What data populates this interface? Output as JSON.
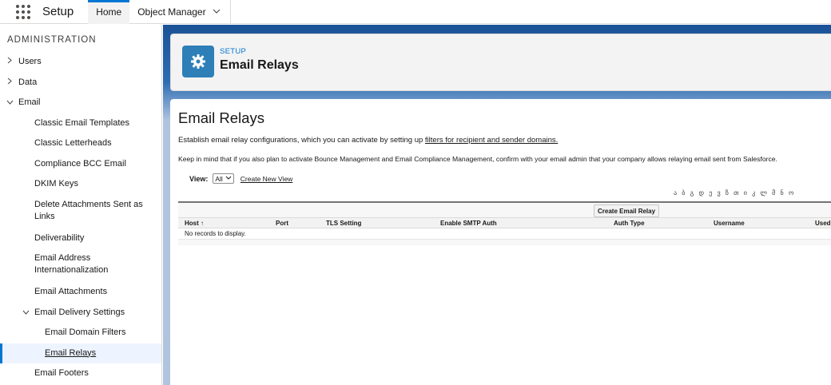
{
  "topbar": {
    "app_name": "Setup",
    "tabs": [
      {
        "label": "Home"
      },
      {
        "label": "Object Manager"
      }
    ]
  },
  "sidebar": {
    "heading": "ADMINISTRATION",
    "items": [
      {
        "label": "Users"
      },
      {
        "label": "Data"
      },
      {
        "label": "Email"
      }
    ],
    "email_children": [
      {
        "label": "Classic Email Templates"
      },
      {
        "label": "Classic Letterheads"
      },
      {
        "label": "Compliance BCC Email"
      },
      {
        "label": "DKIM Keys"
      },
      {
        "label": "Delete Attachments Sent as Links"
      },
      {
        "label": "Deliverability"
      },
      {
        "label": "Email Address Internationalization"
      },
      {
        "label": "Email Attachments"
      },
      {
        "label": "Email Delivery Settings"
      },
      {
        "label": "Email Footers"
      }
    ],
    "delivery_children": [
      {
        "label": "Email Domain Filters"
      },
      {
        "label": "Email Relays"
      }
    ]
  },
  "header": {
    "breadcrumb": "SETUP",
    "title": "Email Relays"
  },
  "content": {
    "title": "Email Relays",
    "desc_prefix": "Establish email relay configurations, which you can activate by setting up ",
    "desc_link": "filters for recipient and sender domains.",
    "note": "Keep in mind that if you also plan to activate Bounce Management and Email Compliance Management, confirm with your email admin that your company allows relaying email sent from Salesforce.",
    "view_label": "View:",
    "view_selected": "All",
    "create_view": "Create New View",
    "alphabet": "ა ბ გ დ ე ვ ზ თ ი კ ლ მ ნ ო",
    "create_button": "Create Email Relay",
    "columns": [
      "Host ↑",
      "Port",
      "TLS Setting",
      "Enable SMTP Auth",
      "Auth Type",
      "Username",
      "Used"
    ],
    "empty": "No records to display."
  }
}
